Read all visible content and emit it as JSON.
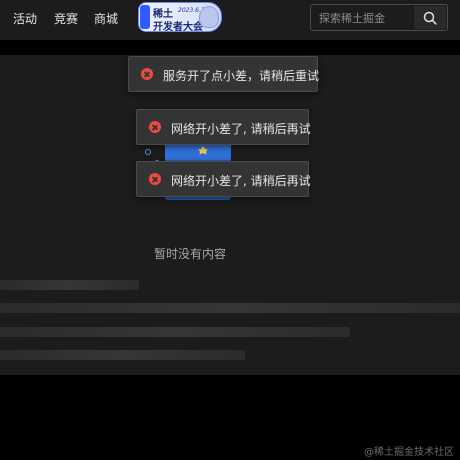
{
  "header": {
    "nav": [
      "活动",
      "竞赛",
      "商城"
    ],
    "banner": {
      "title": "稀土",
      "date": "2023.6.30",
      "subtitle": "开发者大会"
    },
    "search": {
      "placeholder": "探索稀土掘金",
      "value": ""
    }
  },
  "main": {
    "empty_text": "暂时没有内容"
  },
  "toasts": [
    {
      "message": "服务开了点小差，请稍后重试"
    },
    {
      "message": "网络开小差了, 请稍后再试"
    },
    {
      "message": "网络开小差了, 请稍后再试"
    }
  ],
  "watermark": "@稀土掘金技术社区",
  "colors": {
    "page_bg": "#000000",
    "panel_bg": "#1c1c1c",
    "toast_bg": "#343434",
    "error_red": "#ee4b3e",
    "illustration_blue": "#2f6fd6"
  }
}
